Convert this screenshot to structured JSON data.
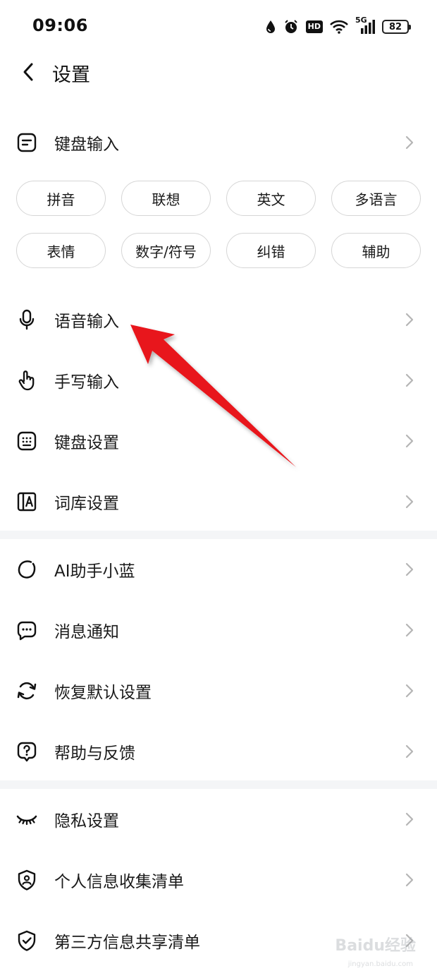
{
  "status_bar": {
    "time": "09:06",
    "signal_label": "5G",
    "hd_label": "HD",
    "battery": "82"
  },
  "header": {
    "title": "设置"
  },
  "keyboard_input": {
    "label": "键盘输入",
    "chips": [
      "拼音",
      "联想",
      "英文",
      "多语言",
      "表情",
      "数字/符号",
      "纠错",
      "辅助"
    ]
  },
  "group1": [
    {
      "label": "语音输入",
      "icon": "microphone-icon"
    },
    {
      "label": "手写输入",
      "icon": "hand-pointer-icon"
    },
    {
      "label": "键盘设置",
      "icon": "keyboard-icon"
    },
    {
      "label": "词库设置",
      "icon": "dictionary-icon"
    }
  ],
  "group2": [
    {
      "label": "AI助手小蓝",
      "icon": "ai-assistant-icon"
    },
    {
      "label": "消息通知",
      "icon": "message-icon"
    },
    {
      "label": "恢复默认设置",
      "icon": "refresh-icon"
    },
    {
      "label": "帮助与反馈",
      "icon": "help-icon"
    }
  ],
  "group3": [
    {
      "label": "隐私设置",
      "icon": "eye-closed-icon"
    },
    {
      "label": "个人信息收集清单",
      "icon": "shield-user-icon"
    },
    {
      "label": "第三方信息共享清单",
      "icon": "shield-check-icon"
    }
  ],
  "watermark": {
    "text": "Baidu经验",
    "sub": "jingyan.baidu.com"
  },
  "colors": {
    "annotation_arrow": "#e8141b",
    "divider": "#f4f5f7",
    "chip_border": "#d6d6d6",
    "chevron": "#b5b5b5"
  }
}
